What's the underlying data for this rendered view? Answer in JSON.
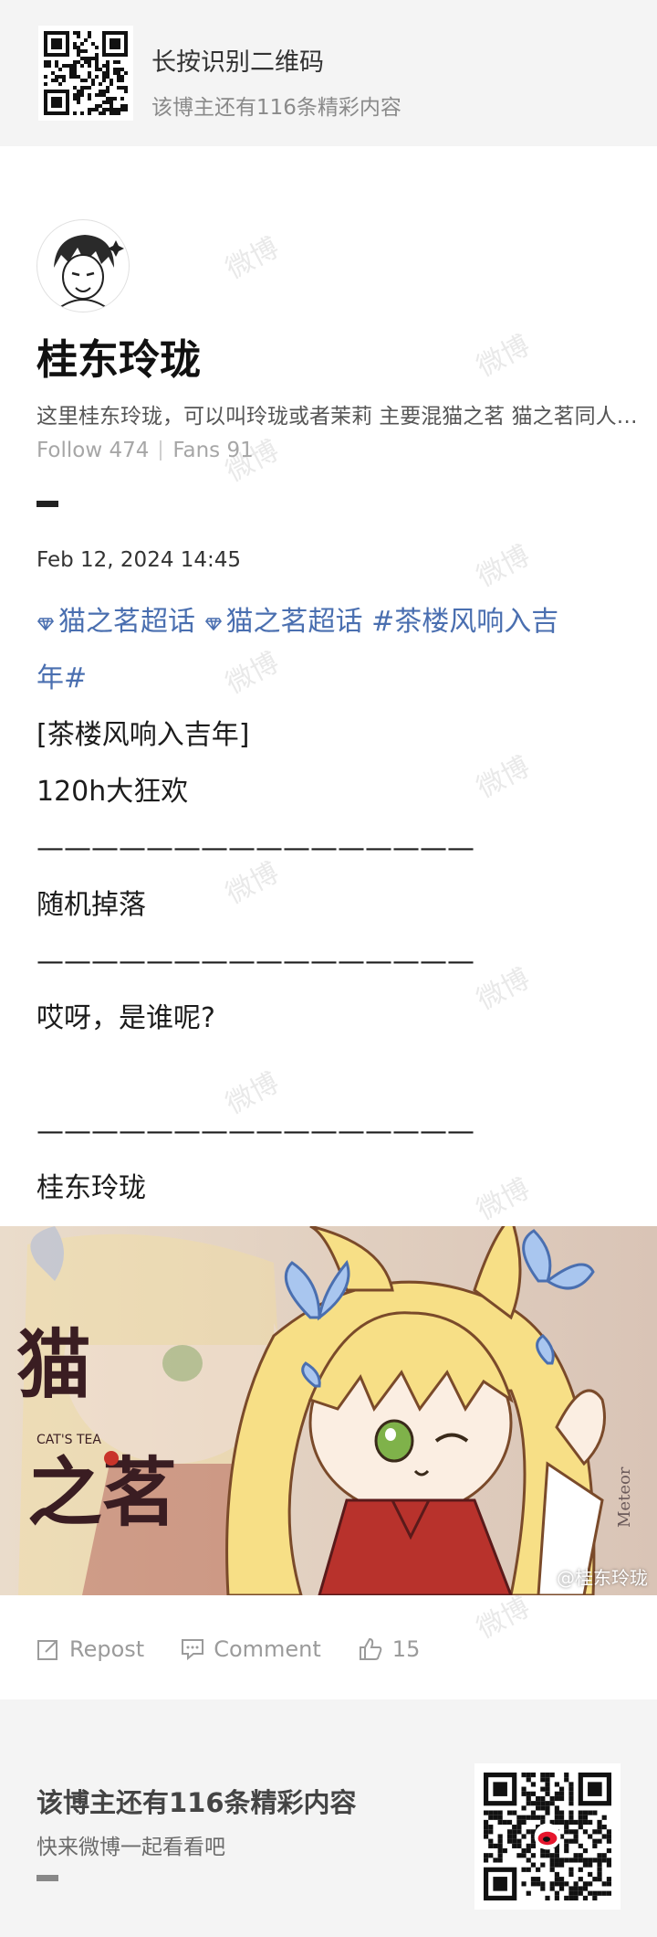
{
  "top_banner": {
    "title": "长按识别二维码",
    "subtitle": "该博主还有116条精彩内容"
  },
  "profile": {
    "name": "桂东玲珑",
    "bio": "这里桂东玲珑，可以叫玲珑或者茉莉 主要混猫之茗 猫之茗同人太太们都很棒！",
    "follow_label": "Follow 474",
    "fans_label": "Fans 91"
  },
  "post": {
    "time": "Feb 12, 2024 14:45",
    "tag1": "猫之茗超话",
    "tag2": "猫之茗超话",
    "tag3_line1": "#茶楼风响入吉",
    "tag3_line2": "年#",
    "line_event": "[茶楼风响入吉年]",
    "line_party": "120h大狂欢",
    "divider": "————————————————",
    "line_drop": "随机掉落",
    "line_who": "哎呀，是谁呢?",
    "signature": "桂东玲珑",
    "image_credit": "@桂东玲珑",
    "logo_text": "猫之茗",
    "logo_en": "CAT'S TEA"
  },
  "actions": {
    "repost": "Repost",
    "comment": "Comment",
    "likes": "15"
  },
  "bottom_banner": {
    "title": "该博主还有116条精彩内容",
    "subtitle": "快来微博一起看看吧"
  },
  "watermark": "微博",
  "colors": {
    "tag_blue": "#4a6fb0",
    "banner_bg": "#f4f4f4"
  }
}
